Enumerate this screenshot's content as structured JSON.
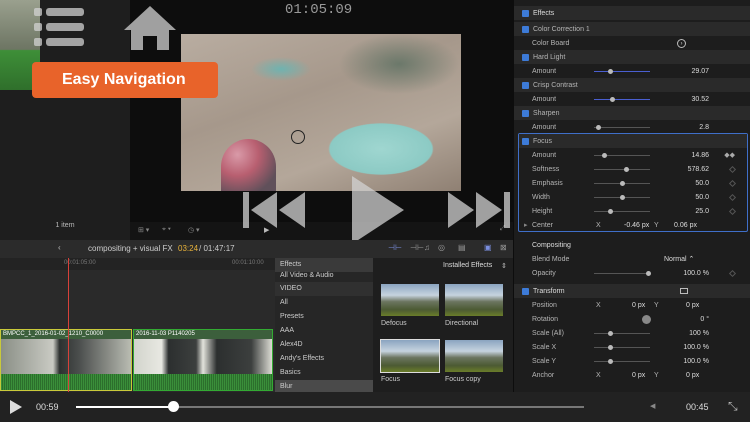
{
  "browser": {
    "items_count": "1 item"
  },
  "viewer": {
    "timecode": "01:05:09"
  },
  "badge": {
    "label": "Easy Navigation"
  },
  "inspector": {
    "effects_header": "Effects",
    "color_correction": "Color Correction 1",
    "color_board": "Color Board",
    "hard_light": "Hard Light",
    "hard_light_amount_label": "Amount",
    "hard_light_amount": "29.07",
    "crisp_contrast": "Crisp Contrast",
    "crisp_amount_label": "Amount",
    "crisp_amount": "30.52",
    "sharpen": "Sharpen",
    "sharpen_amount_label": "Amount",
    "sharpen_amount": "2.8",
    "focus": "Focus",
    "focus_params": [
      {
        "label": "Amount",
        "value": "14.86"
      },
      {
        "label": "Softness",
        "value": "578.62"
      },
      {
        "label": "Emphasis",
        "value": "50.0"
      },
      {
        "label": "Width",
        "value": "50.0"
      },
      {
        "label": "Height",
        "value": "25.0"
      }
    ],
    "center_label": "Center",
    "center_x_label": "X",
    "center_x": "-0.46 px",
    "center_y_label": "Y",
    "center_y": "0.06 px",
    "compositing": "Compositing",
    "blend_mode_label": "Blend Mode",
    "blend_mode": "Normal ⌃",
    "opacity_label": "Opacity",
    "opacity": "100.0 %",
    "transform": "Transform",
    "position_label": "Position",
    "position_x_label": "X",
    "position_x": "0 px",
    "position_y_label": "Y",
    "position_y": "0 px",
    "rotation_label": "Rotation",
    "rotation": "0 °",
    "scale_all_label": "Scale (All)",
    "scale_all": "100 %",
    "scale_x_label": "Scale X",
    "scale_x": "100.0 %",
    "scale_y_label": "Scale Y",
    "scale_y": "100.0 %",
    "anchor_label": "Anchor",
    "anchor_x_label": "X",
    "anchor_x": "0 px",
    "anchor_y_label": "Y",
    "anchor_y": "0 px"
  },
  "timeline": {
    "project": "compositing + visual FX",
    "time_current": "03:24",
    "time_total": " / 01:47:17",
    "ruler_a": "00:01:05:00",
    "ruler_b": "00:01:10:00",
    "clip1": "BMPCC_1_2016-01-02_1210_C0000",
    "clip2": "2016-11-03 P1140205"
  },
  "effects_browser": {
    "cats": [
      "Effects",
      "All Video & Audio",
      "VIDEO",
      "All",
      "Presets",
      "AAA",
      "Alex4D",
      "Andy's Effects",
      "Basics",
      "Blur"
    ],
    "installed": "Installed Effects",
    "tiles": [
      "Defocus",
      "Directional",
      "Focus",
      "Focus copy"
    ]
  },
  "player": {
    "elapsed": "00:59",
    "remaining": "00:45",
    "progress": 0.19
  }
}
